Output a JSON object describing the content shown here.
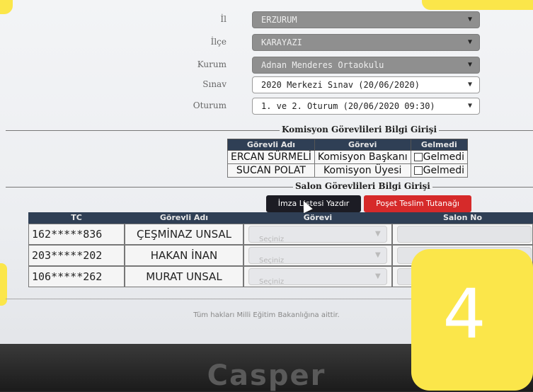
{
  "filters": {
    "il": {
      "label": "İl",
      "value": "ERZURUM"
    },
    "ilce": {
      "label": "İlçe",
      "value": "KARAYAZI"
    },
    "kurum": {
      "label": "Kurum",
      "value": "Adnan Menderes Ortaokulu"
    },
    "sinav": {
      "label": "Sınav",
      "value": "2020 Merkezi Sınav (20/06/2020)"
    },
    "oturum": {
      "label": "Oturum",
      "value": "1. ve 2. Oturum (20/06/2020 09:30)"
    }
  },
  "komisyon": {
    "legend": "Komisyon Görevlileri Bilgi Girişi",
    "headers": [
      "Görevli Adı",
      "Görevi",
      "Gelmedi"
    ],
    "rows": [
      {
        "name": "ERCAN SÜRMELİ",
        "role": "Komisyon Başkanı",
        "absent": "Gelmedi"
      },
      {
        "name": "SUCAN POLAT",
        "role": "Komisyon Üyesi",
        "absent": "Gelmedi"
      }
    ]
  },
  "salon": {
    "legend": "Salon Görevlileri Bilgi Girişi",
    "print_button": "İmza Listesi Yazdır",
    "poset_button": "Poşet Teslim Tutanağı",
    "headers": [
      "TC",
      "Görevli Adı",
      "Görevi",
      "Salon No"
    ],
    "rows": [
      {
        "tc": "162*****836",
        "name": "ÇEŞMİNAZ UNSAL",
        "gorevi": "Seçiniz"
      },
      {
        "tc": "203*****202",
        "name": "HAKAN İNAN",
        "gorevi": "Seçiniz"
      },
      {
        "tc": "106*****262",
        "name": "MURAT UNSAL",
        "gorevi": "Seçiniz"
      }
    ]
  },
  "footer": "Tüm hakları Milli Eğitim Bakanlığına aittir.",
  "badge": "4",
  "brand": "Casper",
  "colors": {
    "table_header": "#2f3f55",
    "print_button": "#1c1c24",
    "poset_button": "#d62a2a",
    "badge": "#fbe64a",
    "disabled_select": "#8f8f8f"
  }
}
